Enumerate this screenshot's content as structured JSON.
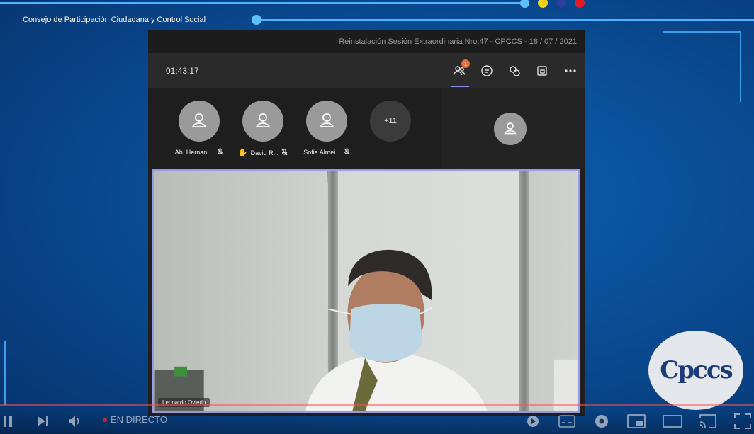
{
  "broadcast": {
    "org_title": "Consejo de Participación Ciudadana y Control Social",
    "accent_colors": [
      "#4fb3ff",
      "#f7d117",
      "#2b3d9e",
      "#e21b2c"
    ]
  },
  "teams": {
    "meeting_title": "Reinstalación Sesión Extraordinaria Nro.47 - CPCCS - 18 / 07 / 2021",
    "timer": "01:43:17",
    "people_badge": "1",
    "toolbar_icons": [
      "people-icon",
      "chat-icon",
      "reactions-icon",
      "share-tray-icon",
      "more-options-icon"
    ],
    "participants": [
      {
        "name": "Ab. Hernan ...",
        "status_icon": "mic-off-icon"
      },
      {
        "name": "David R...",
        "status_icon": "mic-off-icon",
        "hand_raised": true
      },
      {
        "name": "Sofia Almei...",
        "status_icon": "mic-off-icon"
      }
    ],
    "more_count": "+11",
    "video": {
      "speaker_name": "Leonardo Oviedo"
    }
  },
  "logo": {
    "text": "Cpccs"
  },
  "player": {
    "live_label": "EN DIRECTO",
    "icons": [
      "pause-icon",
      "next-icon",
      "volume-icon",
      "autoplay-icon",
      "subtitles-icon",
      "settings-icon",
      "miniplayer-icon",
      "theater-icon",
      "cast-icon",
      "fullscreen-icon"
    ]
  }
}
